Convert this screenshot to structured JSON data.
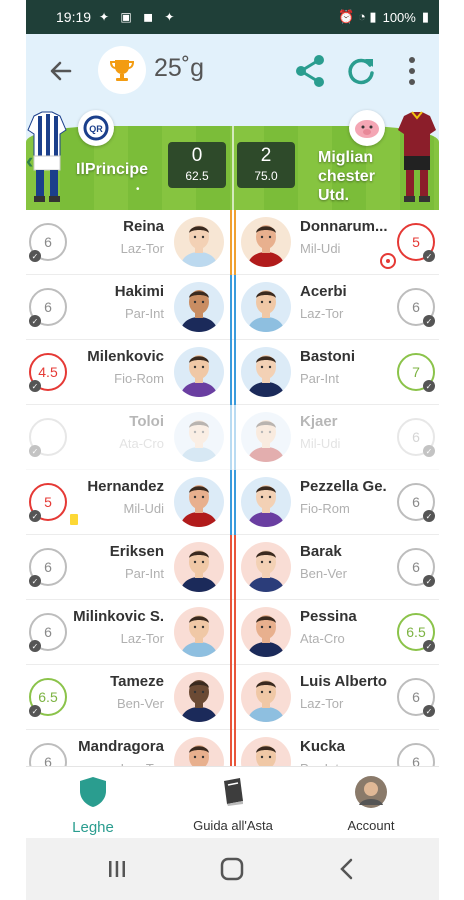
{
  "status_bar": {
    "time": "19:19",
    "battery": "100%"
  },
  "header": {
    "budget": "25˚g"
  },
  "match": {
    "home": {
      "name": "IlPrincipe",
      "goals": "0",
      "points": "62.5"
    },
    "away": {
      "name": "Miglian chester Utd.",
      "goals": "2",
      "points": "75.0"
    }
  },
  "lineups": [
    {
      "home": {
        "name": "Reina",
        "team": "Laz-Tor",
        "vote": "6",
        "vote_color": "gray"
      },
      "away": {
        "name": "Donnarum...",
        "team": "Mil-Udi",
        "vote": "5",
        "vote_color": "red"
      },
      "bar_color": "#f0a030"
    },
    {
      "home": {
        "name": "Hakimi",
        "team": "Par-Int",
        "vote": "6",
        "vote_color": "gray"
      },
      "away": {
        "name": "Acerbi",
        "team": "Laz-Tor",
        "vote": "6",
        "vote_color": "gray"
      },
      "bar_color": "#3a9bdc"
    },
    {
      "home": {
        "name": "Milenkovic",
        "team": "Fio-Rom",
        "vote": "4.5",
        "vote_color": "red"
      },
      "away": {
        "name": "Bastoni",
        "team": "Par-Int",
        "vote": "7",
        "vote_color": "green"
      },
      "bar_color": "#3a9bdc"
    },
    {
      "home": {
        "name": "Toloi",
        "team": "Ata-Cro",
        "vote": "",
        "vote_color": "gray"
      },
      "away": {
        "name": "Kjaer",
        "team": "Mil-Udi",
        "vote": "6",
        "vote_color": "gray"
      },
      "bar_color": "#3a9bdc"
    },
    {
      "home": {
        "name": "Hernandez",
        "team": "Mil-Udi",
        "vote": "5",
        "vote_color": "red"
      },
      "away": {
        "name": "Pezzella Ge.",
        "team": "Fio-Rom",
        "vote": "6",
        "vote_color": "gray"
      },
      "bar_color": "#3a9bdc"
    },
    {
      "home": {
        "name": "Eriksen",
        "team": "Par-Int",
        "vote": "6",
        "vote_color": "gray"
      },
      "away": {
        "name": "Barak",
        "team": "Ben-Ver",
        "vote": "6",
        "vote_color": "gray"
      },
      "bar_color": "#e8553a"
    },
    {
      "home": {
        "name": "Milinkovic S.",
        "team": "Laz-Tor",
        "vote": "6",
        "vote_color": "gray"
      },
      "away": {
        "name": "Pessina",
        "team": "Ata-Cro",
        "vote": "6.5",
        "vote_color": "green"
      },
      "bar_color": "#e8553a"
    },
    {
      "home": {
        "name": "Tameze",
        "team": "Ben-Ver",
        "vote": "6.5",
        "vote_color": "green"
      },
      "away": {
        "name": "Luis Alberto",
        "team": "Laz-Tor",
        "vote": "6",
        "vote_color": "gray"
      },
      "bar_color": "#e8553a"
    },
    {
      "home": {
        "name": "Mandragora",
        "team": "Laz-Tor",
        "vote": "6",
        "vote_color": "gray"
      },
      "away": {
        "name": "Kucka",
        "team": "Par-Int",
        "vote": "6",
        "vote_color": "gray"
      },
      "bar_color": "#e8553a"
    }
  ],
  "bottom_nav": {
    "leghe": "Leghe",
    "guida": "Guida all'Asta",
    "account": "Account"
  },
  "colors": {
    "status_bar": "#1f3f38",
    "header_bg": "#e2f1fb",
    "accent_green": "#2a9d8f",
    "trophy": "#f39c12"
  }
}
